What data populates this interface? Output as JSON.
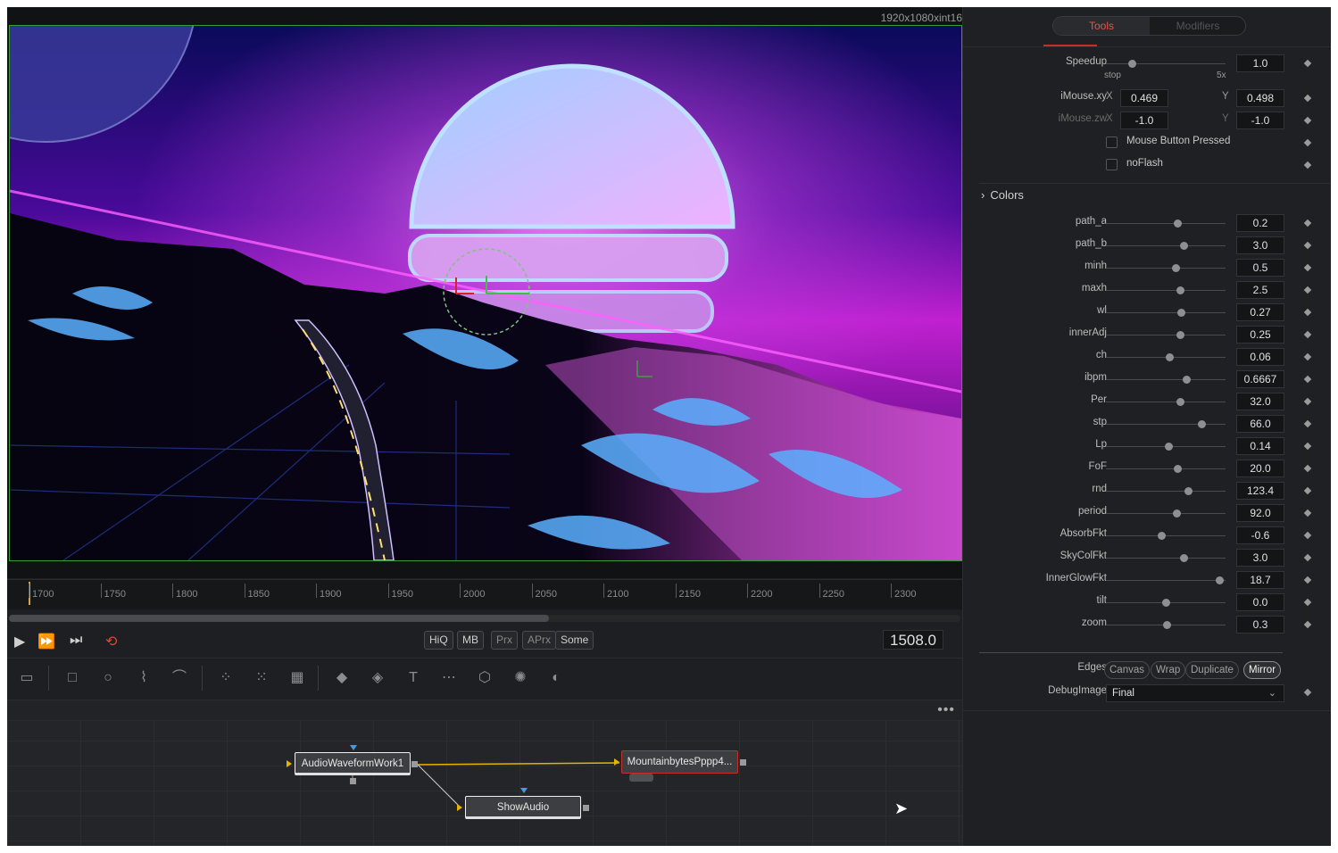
{
  "viewer": {
    "resolution": "1920x1080xint16"
  },
  "timeline": {
    "ticks": [
      "1700",
      "1750",
      "1800",
      "1850",
      "1900",
      "1950",
      "2000",
      "2050",
      "2100",
      "2150",
      "2200",
      "2250",
      "2300"
    ]
  },
  "transport": {
    "play_icon": "play-icon",
    "quality_buttons": [
      "HiQ",
      "MB",
      "Prx",
      "APrx",
      "Some"
    ],
    "current_frame": "1508.0"
  },
  "flow": {
    "nodes": {
      "audio": "AudioWaveformWork1",
      "mountain": "MountainbytesPppp4...",
      "show": "ShowAudio"
    },
    "menu": "•••"
  },
  "inspector": {
    "tabs": {
      "tools": "Tools",
      "modifiers": "Modifiers"
    },
    "speedup": {
      "label": "Speedup",
      "value": "1.0",
      "min_label": "stop",
      "max_label": "5x",
      "level": 0.22
    },
    "imouse_xy": {
      "label": "iMouse.xy",
      "x_label": "X",
      "x": "0.469",
      "y_label": "Y",
      "y": "0.498"
    },
    "imouse_zw": {
      "label": "iMouse.zw",
      "x_label": "X",
      "x": "-1.0",
      "y_label": "Y",
      "y": "-1.0"
    },
    "mouse_button": {
      "label": "Mouse Button Pressed",
      "checked": false
    },
    "noflash": {
      "label": "noFlash",
      "checked": false
    },
    "colors_section": {
      "chevron": "›",
      "label": "Colors"
    },
    "params": [
      {
        "label": "path_a",
        "value": "0.2",
        "level": 0.6
      },
      {
        "label": "path_b",
        "value": "3.0",
        "level": 0.65
      },
      {
        "label": "minh",
        "value": "0.5",
        "level": 0.58
      },
      {
        "label": "maxh",
        "value": "2.5",
        "level": 0.62
      },
      {
        "label": "wl",
        "value": "0.27",
        "level": 0.63
      },
      {
        "label": "innerAdj",
        "value": "0.25",
        "level": 0.62
      },
      {
        "label": "ch",
        "value": "0.06",
        "level": 0.53
      },
      {
        "label": "ibpm",
        "value": "0.6667",
        "level": 0.67
      },
      {
        "label": "Per",
        "value": "32.0",
        "level": 0.62
      },
      {
        "label": "stp",
        "value": "66.0",
        "level": 0.8
      },
      {
        "label": "Lp",
        "value": "0.14",
        "level": 0.52
      },
      {
        "label": "FoF",
        "value": "20.0",
        "level": 0.6
      },
      {
        "label": "rnd",
        "value": "123.4",
        "level": 0.69
      },
      {
        "label": "period",
        "value": "92.0",
        "level": 0.59
      },
      {
        "label": "AbsorbFkt",
        "value": "-0.6",
        "level": 0.46
      },
      {
        "label": "SkyColFkt",
        "value": "3.0",
        "level": 0.65
      },
      {
        "label": "InnerGlowFkt",
        "value": "18.7",
        "level": 0.95
      },
      {
        "label": "tilt",
        "value": "0.0",
        "level": 0.5
      },
      {
        "label": "zoom",
        "value": "0.3",
        "level": 0.51
      }
    ],
    "edges": {
      "label": "Edges",
      "options": [
        "Canvas",
        "Wrap",
        "Duplicate",
        "Mirror"
      ],
      "selected": "Mirror"
    },
    "debug_image": {
      "label": "DebugImage",
      "value": "Final"
    }
  },
  "colors": {
    "accent": "#e4574a",
    "viewer_border": "#3a9a3a",
    "node_link": "#e5b400"
  }
}
